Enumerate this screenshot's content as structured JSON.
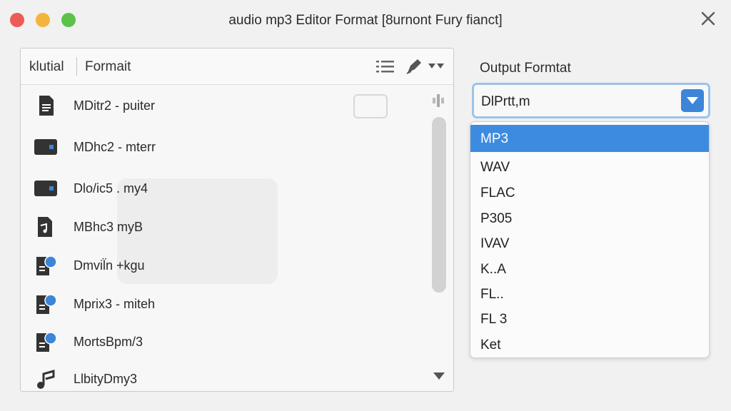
{
  "window": {
    "title": "audio mp3 Editor Format [8urnont Fury fianct]"
  },
  "file_panel": {
    "column_name": "klutial",
    "column_format": "Formait",
    "files": [
      {
        "name": "MDitr2 - puiter",
        "icon": "document-icon"
      },
      {
        "name": "MDhc2 - mterr",
        "icon": "media-file-icon"
      },
      {
        "name": "Dlo/ic5 . my4",
        "icon": "media-file-icon"
      },
      {
        "name": "MBhc3 myB",
        "icon": "audio-document-icon"
      },
      {
        "name": "Dmvil̈n +kgu",
        "icon": "audio-file-badge-icon"
      },
      {
        "name": "Mprix3 - miteh",
        "icon": "audio-file-badge-icon"
      },
      {
        "name": "MortsBpm/3",
        "icon": "audio-file-badge-icon"
      },
      {
        "name": "LlbityDmy3",
        "icon": "music-note-icon"
      }
    ]
  },
  "output": {
    "label": "Output Formtat",
    "selected_value": "DlPrtt,m",
    "options": [
      "MP3",
      "WAV",
      "FLAC",
      "P305",
      "IVAV",
      "K..A",
      "FL..",
      "FL 3",
      "Ket"
    ],
    "highlighted_option": "MP3"
  },
  "colors": {
    "accent": "#3d8be0",
    "select_border": "#9cc3ea",
    "badge_blue": "#3d85d8"
  }
}
